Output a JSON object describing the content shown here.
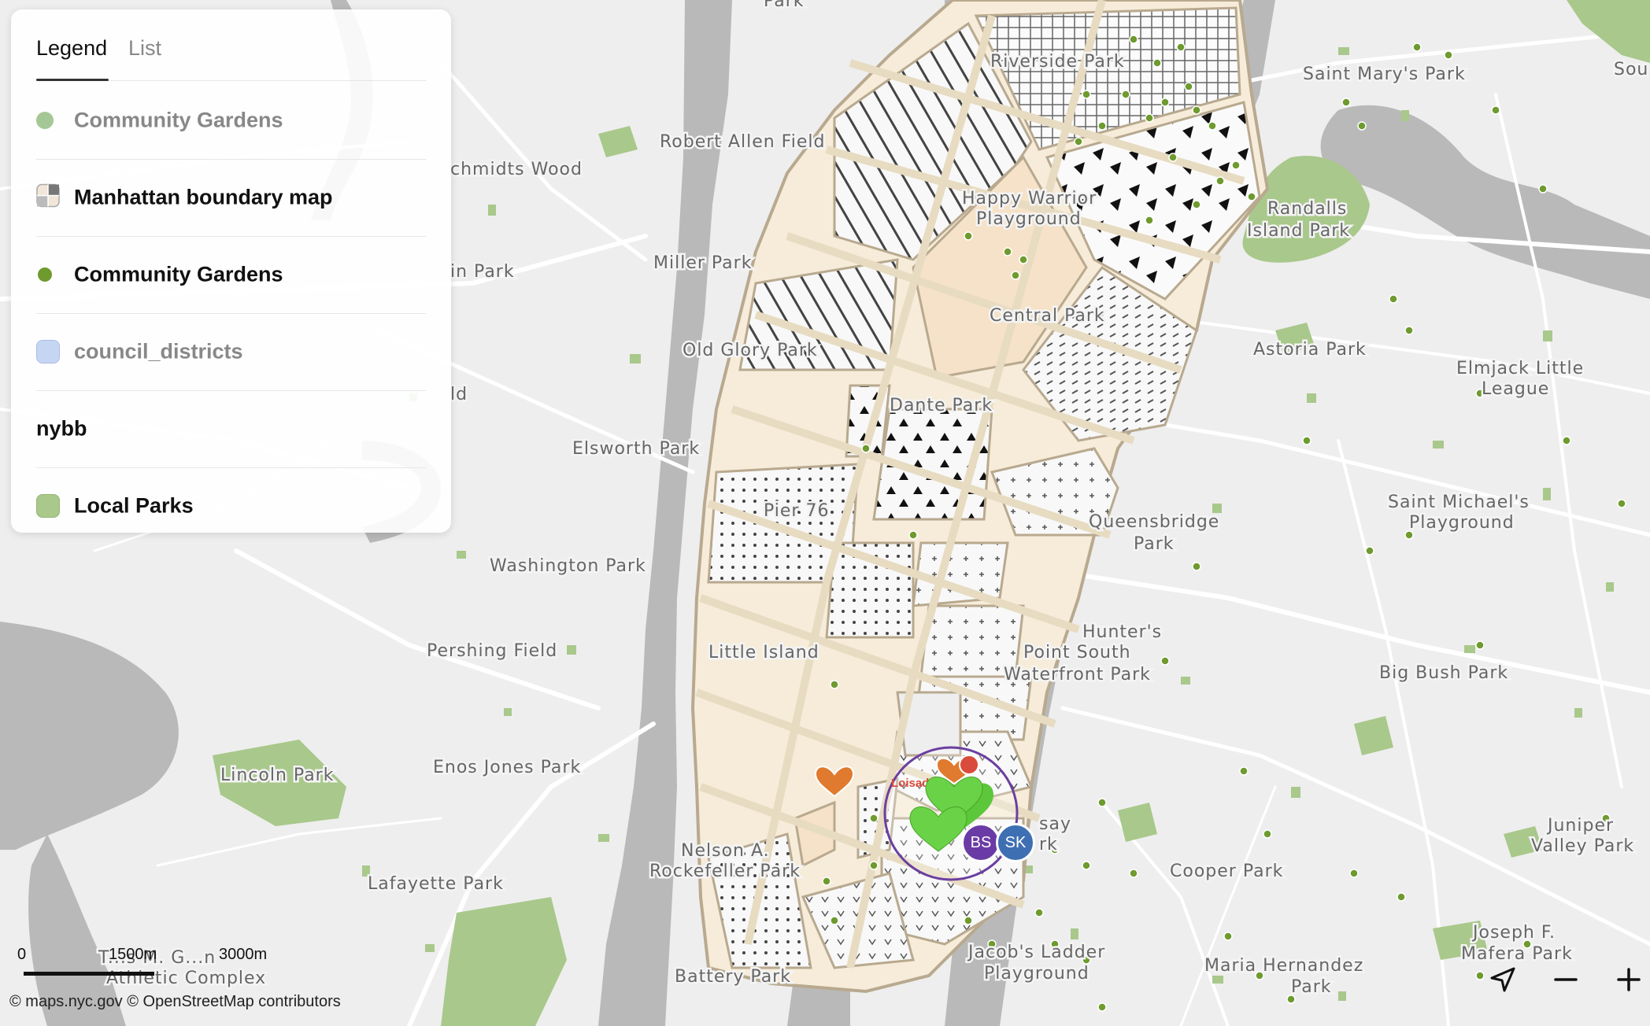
{
  "map": {
    "place_labels": [
      {
        "text": "Park"
      },
      {
        "text": "Riverside Park"
      },
      {
        "text": "Saint Mary's Park"
      },
      {
        "text": "Sou"
      },
      {
        "text": "Robert Allen Field"
      },
      {
        "text": "chmidts Wood"
      },
      {
        "text": "Happy Warrior"
      },
      {
        "text": "Playground"
      },
      {
        "text": "Randalls"
      },
      {
        "text": "Island Park"
      },
      {
        "text": "Miller Park"
      },
      {
        "text": "in Park"
      },
      {
        "text": "Central Park"
      },
      {
        "text": "Old Glory Park"
      },
      {
        "text": "Astoria Park"
      },
      {
        "text": "Elmjack Little"
      },
      {
        "text": "League"
      },
      {
        "text": "Dante Park"
      },
      {
        "text": "ld"
      },
      {
        "text": "Elsworth Park"
      },
      {
        "text": "Saint Michael's"
      },
      {
        "text": "Playground"
      },
      {
        "text": "Pier 76"
      },
      {
        "text": "Queensbridge"
      },
      {
        "text": "Park"
      },
      {
        "text": "Washington Park"
      },
      {
        "text": "Hunter's"
      },
      {
        "text": "Point South"
      },
      {
        "text": "Waterfront Park"
      },
      {
        "text": "Pershing Field"
      },
      {
        "text": "Little Island"
      },
      {
        "text": "Big Bush Park"
      },
      {
        "text": "Lincoln Park"
      },
      {
        "text": "Enos Jones Park"
      },
      {
        "text": "Nelson A."
      },
      {
        "text": "Rockefeller Park"
      },
      {
        "text": "Cooper Park"
      },
      {
        "text": "Juniper"
      },
      {
        "text": "Valley Park"
      },
      {
        "text": "Lafayette Park"
      },
      {
        "text": "Joseph F."
      },
      {
        "text": "Mafera Park"
      },
      {
        "text": "T...s M. G...n"
      },
      {
        "text": "Athletic Complex"
      },
      {
        "text": "Jacob's Ladder"
      },
      {
        "text": "Playground"
      },
      {
        "text": "Maria Hernandez"
      },
      {
        "text": "Park"
      },
      {
        "text": "Battery Park"
      },
      {
        "text": "say"
      },
      {
        "text": "rk"
      }
    ],
    "marker_label": "Loisada",
    "marker_colors": {
      "orange": "#e07a2e",
      "red": "#d94b3c",
      "green": "#5cc73a",
      "ring": "#6b3fa0"
    },
    "park_color": "#a9c88b",
    "garden_dot_color": "#6e9a2e",
    "boundary_fill": "#f6ecd9",
    "boundary_stroke": "#b8a98f"
  },
  "legend_panel": {
    "tabs": [
      "Legend",
      "List"
    ],
    "active_tab": "Legend",
    "items": [
      {
        "label": "Community Gardens",
        "swatch": "dot",
        "color": "#a5c795",
        "muted": true
      },
      {
        "label": "Manhattan boundary map",
        "swatch": "grid-icon",
        "muted": false
      },
      {
        "label": "Community Gardens",
        "swatch": "dot",
        "color": "#6e9a2e",
        "muted": false
      },
      {
        "label": "council_districts",
        "swatch": "square",
        "color": "#c6d6f2",
        "muted": true
      },
      {
        "label": "nybb",
        "swatch": "none",
        "muted": false
      },
      {
        "label": "Local Parks",
        "swatch": "square",
        "color": "#a9c88b",
        "muted": false
      }
    ]
  },
  "scale": {
    "ticks": [
      "0",
      "1500m",
      "3000m"
    ]
  },
  "attribution": "© maps.nyc.gov © OpenStreetMap contributors",
  "avatars": [
    {
      "initials": "BS",
      "color": "#6a3ba5"
    },
    {
      "initials": "SK",
      "color": "#3f6fb3"
    }
  ],
  "controls": {
    "locate": "navigation-arrow-icon",
    "zoom_out": "minus-icon",
    "zoom_in": "plus-icon"
  }
}
